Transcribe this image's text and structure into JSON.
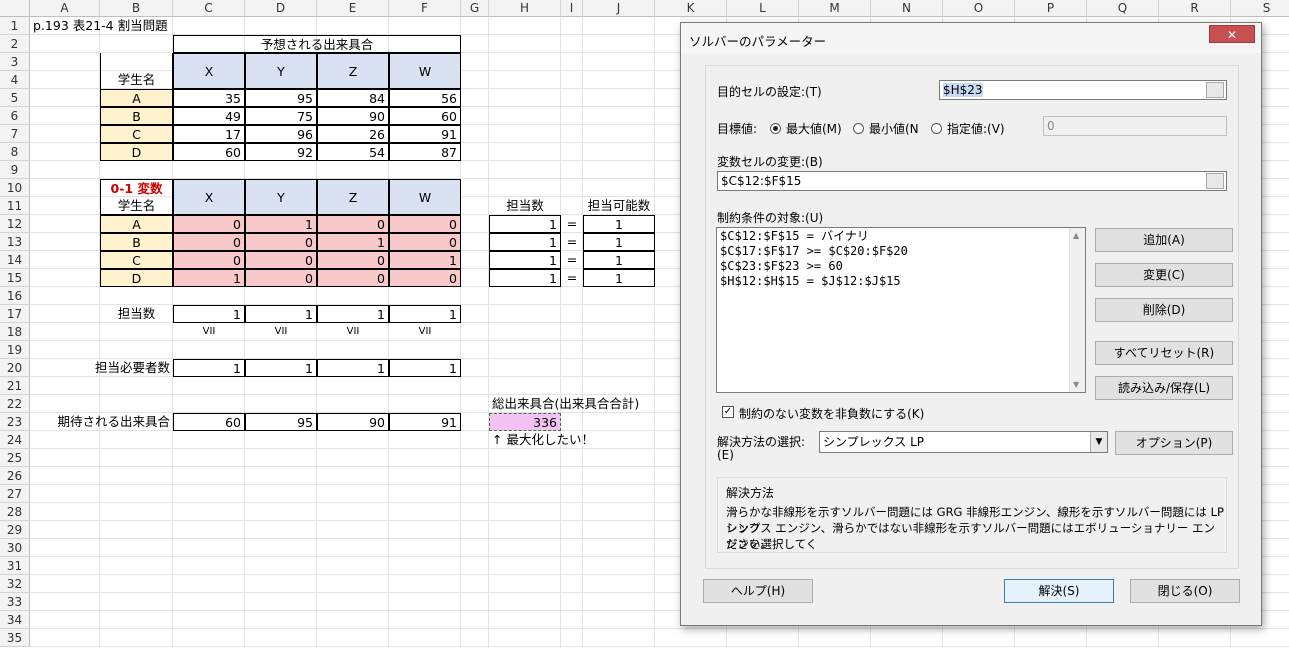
{
  "columns": [
    "A",
    "B",
    "C",
    "D",
    "E",
    "F",
    "G",
    "H",
    "I",
    "J",
    "K",
    "L",
    "M",
    "N",
    "O",
    "P",
    "Q",
    "R",
    "S"
  ],
  "rows": [
    "1",
    "2",
    "3",
    "4",
    "5",
    "6",
    "7",
    "8",
    "9",
    "10",
    "11",
    "12",
    "13",
    "14",
    "15",
    "16",
    "17",
    "18",
    "19",
    "20",
    "21",
    "22",
    "23",
    "24",
    "25",
    "26",
    "27",
    "28",
    "29",
    "30",
    "31",
    "32",
    "33",
    "34",
    "35"
  ],
  "sheet": {
    "title": "p.193 表21-4 割当問題",
    "expected_header": "予想される出来具合",
    "student_label": "学生名",
    "subjects": [
      "X",
      "Y",
      "Z",
      "W"
    ],
    "students": [
      "A",
      "B",
      "C",
      "D"
    ],
    "scores": [
      [
        "35",
        "95",
        "84",
        "56"
      ],
      [
        "49",
        "75",
        "90",
        "60"
      ],
      [
        "17",
        "96",
        "26",
        "91"
      ],
      [
        "60",
        "92",
        "54",
        "87"
      ]
    ],
    "binary_label": "0-1 変数",
    "binary": [
      [
        "0",
        "1",
        "0",
        "0"
      ],
      [
        "0",
        "0",
        "1",
        "0"
      ],
      [
        "0",
        "0",
        "0",
        "1"
      ],
      [
        "1",
        "0",
        "0",
        "0"
      ]
    ],
    "assigned_label": "担当数",
    "capacity_label": "担当可能数",
    "assigned_counts": [
      "1",
      "1",
      "1",
      "1"
    ],
    "equals": "=",
    "capacity_values": [
      "1",
      "1",
      "1",
      "1"
    ],
    "col_assigned_label": "担当数",
    "col_assigned": [
      "1",
      "1",
      "1",
      "1"
    ],
    "ge_symbol": "VII",
    "required_label": "担当必要者数",
    "required": [
      "1",
      "1",
      "1",
      "1"
    ],
    "total_label": "総出来具合(出来具合合計)",
    "total_value": "336",
    "maximize_note": "↑ 最大化したい！",
    "expected_label": "期待される出来具合",
    "expected_values": [
      "60",
      "95",
      "90",
      "91"
    ]
  },
  "dialog": {
    "title": "ソルバーのパラメーター",
    "close_label": "✕",
    "objective_label": "目的セルの設定:(T)",
    "objective_value": "$H$23",
    "target_label": "目標値:",
    "opt_max": "最大値(M)",
    "opt_min": "最小値(N",
    "opt_value": "指定値:(V)",
    "value_field": "0",
    "variable_label": "変数セルの変更:(B)",
    "variable_value": "$C$12:$F$15",
    "constraints_label": "制約条件の対象:(U)",
    "constraints": [
      "$C$12:$F$15 = バイナリ",
      "$C$17:$F$17 >= $C$20:$F$20",
      "$C$23:$F$23 >= 60",
      "$H$12:$H$15 = $J$12:$J$15"
    ],
    "btn_add": "追加(A)",
    "btn_change": "変更(C)",
    "btn_delete": "削除(D)",
    "btn_reset": "すべてリセット(R)",
    "btn_load": "読み込み/保存(L)",
    "nonneg_label": "制約のない変数を非負数にする(K)",
    "nonneg_checked": "✓",
    "method_label_1": "解決方法の選択:",
    "method_label_2": "(E)",
    "method_value": "シンプレックス LP",
    "btn_options": "オプション(P)",
    "method_group_title": "解決方法",
    "method_desc_1": "滑らかな非線形を示すソルバー問題には GRG 非線形エンジン、線形を示すソルバー問題には LP シンプ",
    "method_desc_2": "レックス エンジン、滑らかではない非線形を示すソルバー問題にはエボリューショナリー エンジンを選択してく",
    "method_desc_3": "ださい。",
    "btn_help": "ヘルプ(H)",
    "btn_solve": "解決(S)",
    "btn_close": "閉じる(O)"
  }
}
